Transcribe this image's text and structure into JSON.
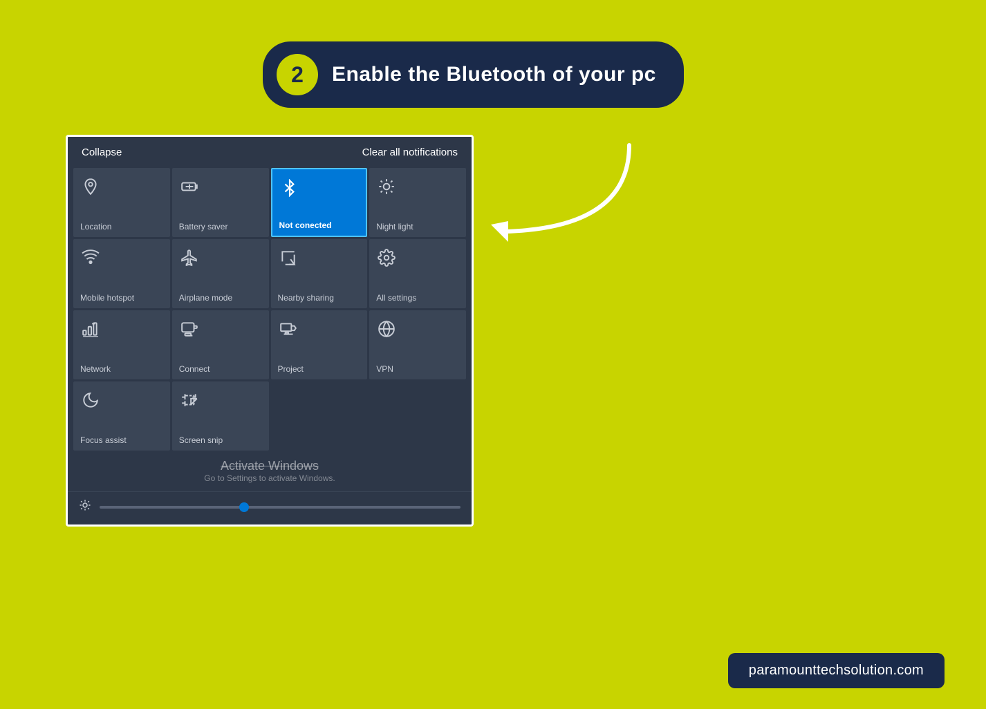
{
  "step": {
    "number": "2",
    "text": "Enable the Bluetooth of your pc"
  },
  "action_center": {
    "collapse_label": "Collapse",
    "clear_label": "Clear all notifications",
    "tiles": [
      {
        "id": "location",
        "icon": "📍",
        "label": "Location",
        "active": false,
        "unicode": "⬡"
      },
      {
        "id": "battery-saver",
        "icon": "🔋",
        "label": "Battery saver",
        "active": false
      },
      {
        "id": "bluetooth",
        "icon": "✱",
        "label": "Not conected",
        "active": true
      },
      {
        "id": "night-light",
        "icon": "☀",
        "label": "Night light",
        "active": false
      },
      {
        "id": "mobile-hotspot",
        "icon": "📶",
        "label": "Mobile hotspot",
        "active": false
      },
      {
        "id": "airplane-mode",
        "icon": "✈",
        "label": "Airplane mode",
        "active": false
      },
      {
        "id": "nearby-sharing",
        "icon": "⇪",
        "label": "Nearby sharing",
        "active": false
      },
      {
        "id": "all-settings",
        "icon": "⚙",
        "label": "All settings",
        "active": false
      },
      {
        "id": "network",
        "icon": "📶",
        "label": "Network",
        "active": false
      },
      {
        "id": "connect",
        "icon": "🖥",
        "label": "Connect",
        "active": false
      },
      {
        "id": "project",
        "icon": "🖵",
        "label": "Project",
        "active": false
      },
      {
        "id": "vpn",
        "icon": "⁖",
        "label": "VPN",
        "active": false
      },
      {
        "id": "focus-assist",
        "icon": "🌙",
        "label": "Focus assist",
        "active": false
      },
      {
        "id": "screen-snip",
        "icon": "✂",
        "label": "Screen snip",
        "active": false
      }
    ],
    "activate_title": "Activate Windows",
    "activate_subtitle": "Go to Settings to activate Windows."
  },
  "footer": {
    "brand": "paramounttechsolution.com"
  }
}
